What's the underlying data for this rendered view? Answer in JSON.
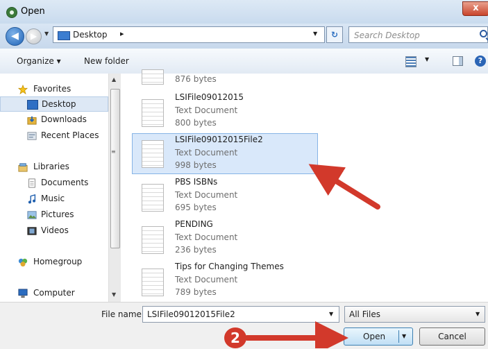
{
  "window": {
    "title": "Open",
    "close_symbol": "x",
    "accent": "#c9452c"
  },
  "navigation": {
    "back_symbol": "◀",
    "forward_symbol": "▶",
    "address": {
      "location": "Desktop",
      "separator": "▸",
      "dropdown": "▼"
    },
    "refresh_symbol": "↻",
    "search_placeholder": "Search Desktop"
  },
  "toolbar": {
    "organize_label": "Organize ▾",
    "new_folder_label": "New folder",
    "view_dropdown": "▼",
    "help_symbol": "?"
  },
  "sidebar": {
    "items": [
      {
        "label": "Favorites",
        "icon": "star-icon"
      },
      {
        "label": "Desktop",
        "icon": "desktop-icon",
        "selected": true
      },
      {
        "label": "Downloads",
        "icon": "downloads-icon"
      },
      {
        "label": "Recent Places",
        "icon": "recent-places-icon"
      },
      {
        "label": "Libraries",
        "icon": "libraries-icon"
      },
      {
        "label": "Documents",
        "icon": "documents-icon"
      },
      {
        "label": "Music",
        "icon": "music-icon"
      },
      {
        "label": "Pictures",
        "icon": "pictures-icon"
      },
      {
        "label": "Videos",
        "icon": "videos-icon"
      },
      {
        "label": "Homegroup",
        "icon": "homegroup-icon"
      },
      {
        "label": "Computer",
        "icon": "computer-icon"
      }
    ]
  },
  "files": [
    {
      "name": "",
      "type": "",
      "size": "876 bytes"
    },
    {
      "name": "LSIFile09012015",
      "type": "Text Document",
      "size": "800 bytes"
    },
    {
      "name": "LSIFile09012015File2",
      "type": "Text Document",
      "size": "998 bytes",
      "selected": true
    },
    {
      "name": "PBS ISBNs",
      "type": "Text Document",
      "size": "695 bytes"
    },
    {
      "name": "PENDING",
      "type": "Text Document",
      "size": "236 bytes"
    },
    {
      "name": "Tips for Changing Themes",
      "type": "Text Document",
      "size": "789 bytes"
    }
  ],
  "bottom": {
    "file_name_label": "File name:",
    "file_name_value": "LSIFile09012015File2",
    "filter_value": "All Files",
    "dropdown": "▼",
    "open_label": "Open",
    "cancel_label": "Cancel"
  },
  "annotation": {
    "step_number": "2",
    "arrow_color": "#d2392b"
  }
}
